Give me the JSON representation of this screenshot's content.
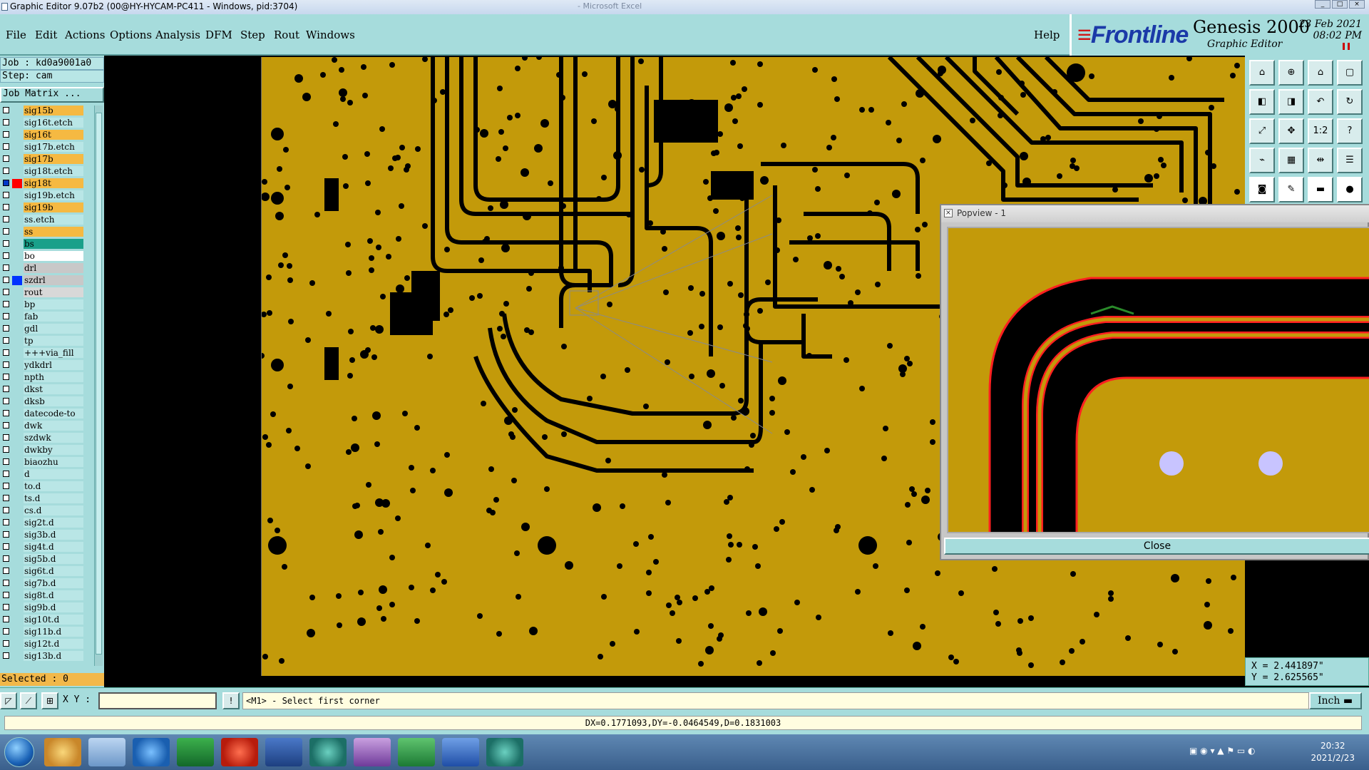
{
  "window": {
    "title": "Graphic Editor 9.07b2 (00@HY-HYCAM-PC411 - Windows, pid:3704)",
    "background_title": "- Microsoft Excel"
  },
  "menu": {
    "items": [
      "File",
      "Edit",
      "Actions",
      "Options",
      "Analysis",
      "DFM",
      "Step",
      "Rout",
      "Windows"
    ],
    "help": "Help"
  },
  "brand": {
    "logo": "Frontline",
    "product": "Genesis 2000",
    "subtitle": "Graphic Editor",
    "date": "23 Feb 2021",
    "time": "08:02 PM"
  },
  "job": {
    "job_line": "Job : kd0a9001a0",
    "step_line": "Step: cam",
    "matrix_button": "Job Matrix ..."
  },
  "layers": [
    {
      "name": "sig15b",
      "bg": "#f5b942",
      "checked": false
    },
    {
      "name": "sig16t.etch",
      "bg": "#b9e6e6",
      "checked": false
    },
    {
      "name": "sig16t",
      "bg": "#f5b942",
      "checked": false
    },
    {
      "name": "sig17b.etch",
      "bg": "#b9e6e6",
      "checked": false
    },
    {
      "name": "sig17b",
      "bg": "#f5b942",
      "checked": false
    },
    {
      "name": "sig18t.etch",
      "bg": "#b9e6e6",
      "checked": false
    },
    {
      "name": "sig18t",
      "bg": "#f5b942",
      "checked": true,
      "swatch": "#ff0000"
    },
    {
      "name": "sig19b.etch",
      "bg": "#b9e6e6",
      "checked": false
    },
    {
      "name": "sig19b",
      "bg": "#f5b942",
      "checked": false
    },
    {
      "name": "ss.etch",
      "bg": "#b9e6e6",
      "checked": false
    },
    {
      "name": "ss",
      "bg": "#f5b942",
      "checked": false
    },
    {
      "name": "bs",
      "bg": "#1aa08a",
      "checked": false
    },
    {
      "name": "bo",
      "bg": "#ffffff",
      "checked": false
    },
    {
      "name": "drl",
      "bg": "#c8c8c8",
      "checked": false
    },
    {
      "name": "szdrl",
      "bg": "#c8c8c8",
      "checked": false,
      "swatch": "#0033ff"
    },
    {
      "name": "rout",
      "bg": "#d8d8d8",
      "checked": false
    },
    {
      "name": "bp",
      "bg": "#b9e6e6",
      "checked": false
    },
    {
      "name": "fab",
      "bg": "#b9e6e6",
      "checked": false
    },
    {
      "name": "gdl",
      "bg": "#b9e6e6",
      "checked": false
    },
    {
      "name": "tp",
      "bg": "#b9e6e6",
      "checked": false
    },
    {
      "name": "+++via_fill",
      "bg": "#b9e6e6",
      "checked": false
    },
    {
      "name": "ydkdrl",
      "bg": "#b9e6e6",
      "checked": false
    },
    {
      "name": "npth",
      "bg": "#b9e6e6",
      "checked": false
    },
    {
      "name": "dkst",
      "bg": "#b9e6e6",
      "checked": false
    },
    {
      "name": "dksb",
      "bg": "#b9e6e6",
      "checked": false
    },
    {
      "name": "datecode-to",
      "bg": "#b9e6e6",
      "checked": false
    },
    {
      "name": "dwk",
      "bg": "#b9e6e6",
      "checked": false
    },
    {
      "name": "szdwk",
      "bg": "#b9e6e6",
      "checked": false
    },
    {
      "name": "dwkby",
      "bg": "#b9e6e6",
      "checked": false
    },
    {
      "name": "biaozhu",
      "bg": "#b9e6e6",
      "checked": false
    },
    {
      "name": "d",
      "bg": "#b9e6e6",
      "checked": false
    },
    {
      "name": "to.d",
      "bg": "#b9e6e6",
      "checked": false
    },
    {
      "name": "ts.d",
      "bg": "#b9e6e6",
      "checked": false
    },
    {
      "name": "cs.d",
      "bg": "#b9e6e6",
      "checked": false
    },
    {
      "name": "sig2t.d",
      "bg": "#b9e6e6",
      "checked": false
    },
    {
      "name": "sig3b.d",
      "bg": "#b9e6e6",
      "checked": false
    },
    {
      "name": "sig4t.d",
      "bg": "#b9e6e6",
      "checked": false
    },
    {
      "name": "sig5b.d",
      "bg": "#b9e6e6",
      "checked": false
    },
    {
      "name": "sig6t.d",
      "bg": "#b9e6e6",
      "checked": false
    },
    {
      "name": "sig7b.d",
      "bg": "#b9e6e6",
      "checked": false
    },
    {
      "name": "sig8t.d",
      "bg": "#b9e6e6",
      "checked": false
    },
    {
      "name": "sig9b.d",
      "bg": "#b9e6e6",
      "checked": false
    },
    {
      "name": "sig10t.d",
      "bg": "#b9e6e6",
      "checked": false
    },
    {
      "name": "sig11b.d",
      "bg": "#b9e6e6",
      "checked": false
    },
    {
      "name": "sig12t.d",
      "bg": "#b9e6e6",
      "checked": false
    },
    {
      "name": "sig13b.d",
      "bg": "#b9e6e6",
      "checked": false
    }
  ],
  "selected_label": "Selected : 0",
  "toolbar_icons": [
    "zoom-home-icon",
    "zoom-in-icon",
    "home-icon",
    "window-icon",
    "pan-left-icon",
    "pan-right-icon",
    "zoom-back-icon",
    "redraw-icon",
    "fit-icon",
    "center-icon",
    "one-to-one-icon",
    "help-icon",
    "snap-icon",
    "grid-icon",
    "measure-icon",
    "layers-icon",
    "camera-icon",
    "draw-icon",
    "ruler-icon",
    "point-icon"
  ],
  "toolbar_labels": {
    "one_to_one": "1:2",
    "help": "?"
  },
  "popview": {
    "title": "Popview - 1",
    "close_label": "Close"
  },
  "coords": {
    "x": "X = 2.441897\"",
    "y": "Y = 2.625565\""
  },
  "command": {
    "xy_label": "X Y :",
    "xy_value": "",
    "prompt": "<M1> - Select first corner",
    "unit": "Inch"
  },
  "status": "DX=0.1771093,DY=-0.0464549,D=0.1831003",
  "taskbar": {
    "time": "20:32",
    "date": "2021/2/23"
  },
  "colors": {
    "ui": "#a6dcdc",
    "board": "#c39a0a",
    "trace": "#000000",
    "highlight": "#ff0000"
  }
}
